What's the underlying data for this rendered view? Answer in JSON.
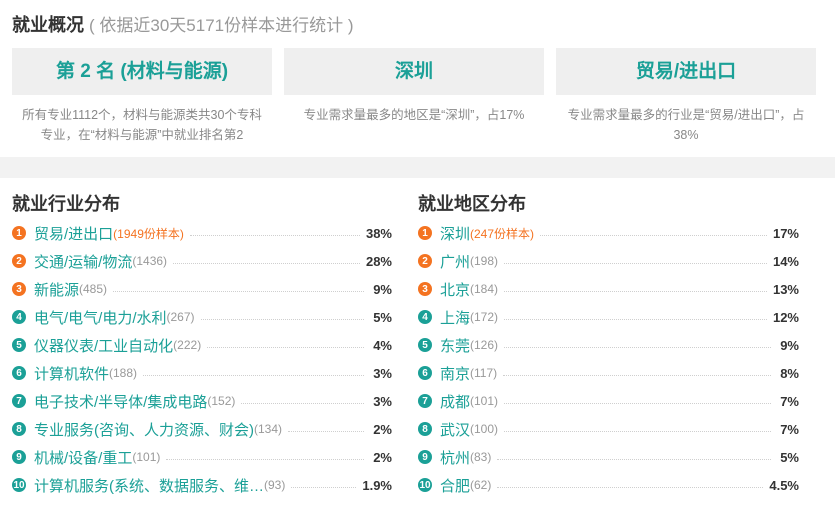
{
  "header": {
    "title": "就业概况",
    "subtitle": "( 依据近30天5171份样本进行统计 )"
  },
  "cards": [
    {
      "headline": "第 2 名 (材料与能源)",
      "desc": "所有专业1112个，材料与能源类共30个专科专业，在“材料与能源”中就业排名第2"
    },
    {
      "headline": "深圳",
      "desc": "专业需求量最多的地区是“深圳”，占17%"
    },
    {
      "headline": "贸易/进出口",
      "desc": "专业需求量最多的行业是“贸易/进出口”，占38%"
    }
  ],
  "industry": {
    "title": "就业行业分布",
    "items": [
      {
        "rank": "1",
        "name": "贸易/进出口",
        "count": "(1949份样本)",
        "pct": "38%"
      },
      {
        "rank": "2",
        "name": "交通/运输/物流",
        "count": "(1436)",
        "pct": "28%"
      },
      {
        "rank": "3",
        "name": "新能源",
        "count": "(485)",
        "pct": "9%"
      },
      {
        "rank": "4",
        "name": "电气/电气/电力/水利",
        "count": "(267)",
        "pct": "5%"
      },
      {
        "rank": "5",
        "name": "仪器仪表/工业自动化",
        "count": "(222)",
        "pct": "4%"
      },
      {
        "rank": "6",
        "name": "计算机软件",
        "count": "(188)",
        "pct": "3%"
      },
      {
        "rank": "7",
        "name": "电子技术/半导体/集成电路",
        "count": "(152)",
        "pct": "3%"
      },
      {
        "rank": "8",
        "name": "专业服务(咨询、人力资源、财会)",
        "count": "(134)",
        "pct": "2%"
      },
      {
        "rank": "9",
        "name": "机械/设备/重工",
        "count": "(101)",
        "pct": "2%"
      },
      {
        "rank": "10",
        "name": "计算机服务(系统、数据服务、维…",
        "count": "(93)",
        "pct": "1.9%"
      }
    ]
  },
  "region": {
    "title": "就业地区分布",
    "items": [
      {
        "rank": "1",
        "name": "深圳",
        "count": "(247份样本)",
        "pct": "17%"
      },
      {
        "rank": "2",
        "name": "广州",
        "count": "(198)",
        "pct": "14%"
      },
      {
        "rank": "3",
        "name": "北京",
        "count": "(184)",
        "pct": "13%"
      },
      {
        "rank": "4",
        "name": "上海",
        "count": "(172)",
        "pct": "12%"
      },
      {
        "rank": "5",
        "name": "东莞",
        "count": "(126)",
        "pct": "9%"
      },
      {
        "rank": "6",
        "name": "南京",
        "count": "(117)",
        "pct": "8%"
      },
      {
        "rank": "7",
        "name": "成都",
        "count": "(101)",
        "pct": "7%"
      },
      {
        "rank": "8",
        "name": "武汉",
        "count": "(100)",
        "pct": "7%"
      },
      {
        "rank": "9",
        "name": "杭州",
        "count": "(83)",
        "pct": "5%"
      },
      {
        "rank": "10",
        "name": "合肥",
        "count": "(62)",
        "pct": "4.5%"
      }
    ]
  },
  "colors": {
    "accent": "#1ba097",
    "hot": "#f47321",
    "card_bg": "#efefef"
  }
}
